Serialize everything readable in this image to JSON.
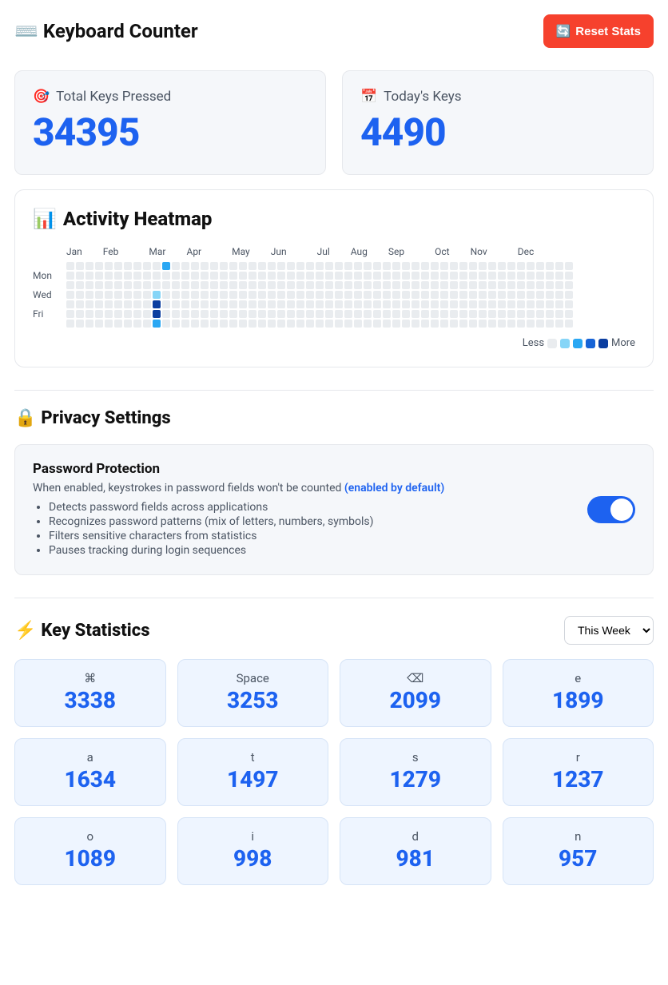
{
  "header": {
    "title": "Keyboard Counter",
    "title_icon": "⌨️",
    "reset_label": "Reset Stats",
    "reset_icon": "🔄"
  },
  "summary": {
    "total": {
      "icon": "🎯",
      "label": "Total Keys Pressed",
      "value": "34395"
    },
    "today": {
      "icon": "📅",
      "label": "Today's Keys",
      "value": "4490"
    }
  },
  "heatmap": {
    "title": "Activity Heatmap",
    "title_icon": "📊",
    "months": [
      "Jan",
      "Feb",
      "Mar",
      "Apr",
      "May",
      "Jun",
      "Jul",
      "Aug",
      "Sep",
      "Oct",
      "Nov",
      "Dec"
    ],
    "day_labels": [
      "",
      "Mon",
      "",
      "Wed",
      "",
      "Fri",
      ""
    ],
    "legend_less": "Less",
    "legend_more": "More",
    "weeks": 53,
    "active_cells": [
      {
        "week": 10,
        "day": 0,
        "level": 2
      },
      {
        "week": 9,
        "day": 3,
        "level": 1
      },
      {
        "week": 9,
        "day": 4,
        "level": 4
      },
      {
        "week": 9,
        "day": 5,
        "level": 4
      },
      {
        "week": 9,
        "day": 6,
        "level": 2
      }
    ]
  },
  "privacy": {
    "section_title": "Privacy Settings",
    "section_icon": "🔒",
    "card": {
      "title": "Password Protection",
      "desc": "When enabled, keystrokes in password fields won't be counted",
      "enabled_tag": "(enabled by default)",
      "bullets": [
        "Detects password fields across applications",
        "Recognizes password patterns (mix of letters, numbers, symbols)",
        "Filters sensitive characters from statistics",
        "Pauses tracking during login sequences"
      ],
      "toggle_on": true
    }
  },
  "keystats": {
    "section_title": "Key Statistics",
    "section_icon": "⚡",
    "range_selected": "This Week",
    "keys": [
      {
        "name": "⌘",
        "count": "3338"
      },
      {
        "name": "Space",
        "count": "3253"
      },
      {
        "name": "⌫",
        "count": "2099"
      },
      {
        "name": "e",
        "count": "1899"
      },
      {
        "name": "a",
        "count": "1634"
      },
      {
        "name": "t",
        "count": "1497"
      },
      {
        "name": "s",
        "count": "1279"
      },
      {
        "name": "r",
        "count": "1237"
      },
      {
        "name": "o",
        "count": "1089"
      },
      {
        "name": "i",
        "count": "998"
      },
      {
        "name": "d",
        "count": "981"
      },
      {
        "name": "n",
        "count": "957"
      }
    ]
  }
}
